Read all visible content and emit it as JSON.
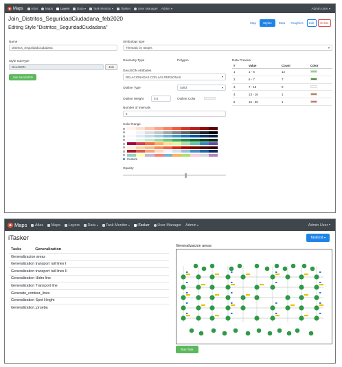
{
  "editor": {
    "nav": {
      "brand": "Maps",
      "items": [
        "Atlas",
        "Maps",
        "Layers",
        "Data",
        "Task Monitor",
        "iTasker",
        "User Manager",
        "Admin"
      ],
      "active_item": "Layers",
      "user": "Admin User"
    },
    "title": "Join_Distritos_SeguridadCiudadana_feb2020",
    "subtitle": "Editing Style \"Distritos_SeguridadCiudadana\"",
    "tabs": [
      "Map",
      "Styles",
      "Data",
      "Graphics"
    ],
    "active_tab": "Styles",
    "edit_label": "Edit",
    "delete_label": "Delete",
    "name_label": "Name",
    "name_value": "Distritos_SeguridadCiudadana",
    "subtype_label": "Style SubType",
    "subtype_value": "GeoJSON",
    "join_small_label": "Join",
    "join_button": "Join GeoJSON",
    "symbology_label": "Simbology type",
    "symbology_value": "Thematic by ranges",
    "geometry_label": "Geometry Type",
    "geometry_value": "Polygon",
    "attrs_label": "GeoJSON Attributes",
    "attrs_value": "RELACIONADAS CON LAS PERSONAS",
    "outline_type_label": "Outline Type",
    "outline_type_value": "Solid",
    "outline_weight_label": "Outline Weight",
    "outline_weight_value": "0.5",
    "outline_color_label": "Outline Color",
    "intervals_label": "Number of Intervals",
    "intervals_value": "5",
    "color_range_label": "Color Range",
    "custom_label": "Custom",
    "opacity_label": "Opacity",
    "opacity_level": 0.6,
    "data_preview_label": "Data Preview",
    "dp_headers": [
      "#",
      "Value",
      "Count",
      "Color"
    ],
    "dp_rows": [
      {
        "n": "1",
        "value": "1 - 6",
        "count": "12",
        "color": "#7ee37a"
      },
      {
        "n": "2",
        "value": "6 - 7",
        "count": "7",
        "color": "#4f8a3f"
      },
      {
        "n": "3",
        "value": "7 - 13",
        "count": "0",
        "color": "#ffffff"
      },
      {
        "n": "4",
        "value": "13 - 16",
        "count": "1",
        "color": "#b9835a"
      },
      {
        "n": "5",
        "value": "16 - 30",
        "count": "1",
        "color": "#e26b62"
      }
    ],
    "palettes": [
      [
        "#fff1ec",
        "#fde0d3",
        "#fcc3ad",
        "#fba386",
        "#f98161",
        "#f0593f",
        "#d93325",
        "#b51d1d",
        "#8a0b13",
        "#5a0008"
      ],
      [
        "#ffffff",
        "#f3f3f3",
        "#dddddd",
        "#c6c6c6",
        "#a6a6a6",
        "#858585",
        "#646464",
        "#444444",
        "#252525",
        "#000000"
      ],
      [
        "#f7fbff",
        "#dcebf7",
        "#c3daee",
        "#9ecae1",
        "#6caed6",
        "#4292c6",
        "#2172b5",
        "#08529c",
        "#08306b",
        "#041c45"
      ],
      [
        "#f7fcf5",
        "#e4f5df",
        "#c7e9c0",
        "#a1d99b",
        "#74c476",
        "#41ab5d",
        "#238b45",
        "#006c2c",
        "#00441b",
        "#002a10"
      ],
      [
        "#9e0142",
        "#d53e4f",
        "#f46d43",
        "#fdae61",
        "#fee08b",
        "#e6f598",
        "#abdda4",
        "#66c2a5",
        "#3288bd",
        "#5e4fa2"
      ],
      [
        "#fef0d9",
        "#fdd49e",
        "#fdbb84",
        "#fc8d59",
        "#ef6548",
        "#d7301f",
        "#b30000",
        "#7f0000",
        "#5c0000",
        "#3a0000"
      ],
      [
        "#b2182b",
        "#d6604d",
        "#f4a582",
        "#fddbc7",
        "#f7f7f7",
        "#d1e5f0",
        "#92c5de",
        "#4393c3",
        "#2166ac",
        "#053061"
      ],
      [
        "#8dd3c7",
        "#ffffb3",
        "#bebada",
        "#fb8072",
        "#80b1d3",
        "#fdb462",
        "#b3de69",
        "#fccde5",
        "#d9d9d9",
        "#bc80bd"
      ]
    ]
  },
  "itasker": {
    "nav": {
      "brand": "Maps",
      "items": [
        "Atlas",
        "Maps",
        "Layers",
        "Data",
        "Task Monitor",
        "iTasker",
        "User Manager",
        "Admin"
      ],
      "active_item": "iTasker",
      "user": "Admin User"
    },
    "title": "iTasker",
    "tasklist_button": "TaskList",
    "headers": [
      "Tasks",
      "Generalization"
    ],
    "tasks": [
      "Generalizacion areas",
      "Generalization transport rail lines I",
      "Generalization transport rail lines II",
      "Generalization Hidro line",
      "Generalization Transport line",
      "Generate_contour_lines",
      "Generalization Spot Height",
      "Generalization_prueba"
    ],
    "diagram_title": "Generalizacion areas",
    "run_button": "Run Task"
  }
}
